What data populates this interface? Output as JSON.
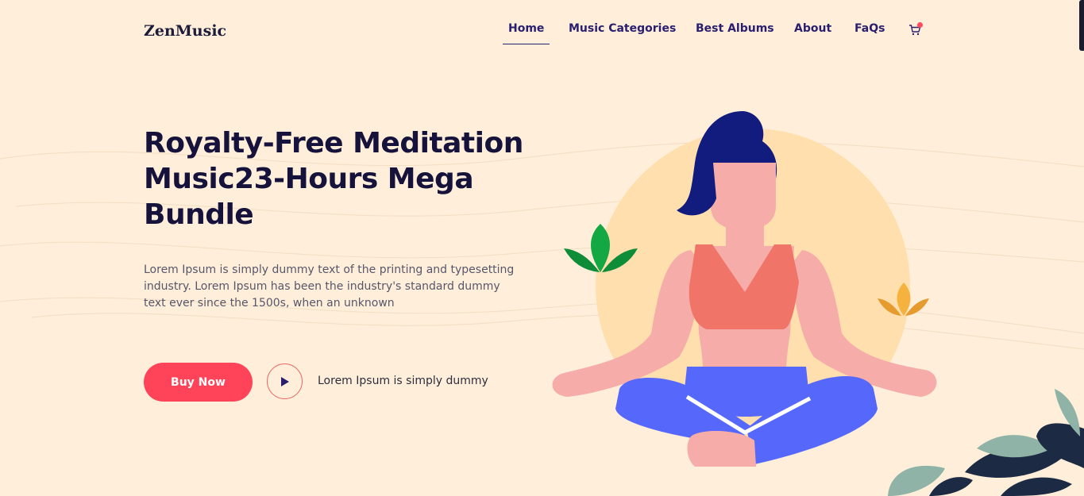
{
  "brand": {
    "logo": "ZenMusic"
  },
  "nav": {
    "items": [
      {
        "label": "Home",
        "active": true
      },
      {
        "label": "Music Categories",
        "active": false
      },
      {
        "label": "Best Albums",
        "active": false
      },
      {
        "label": "About",
        "active": false
      },
      {
        "label": "FaQs",
        "active": false
      }
    ],
    "cart_icon": "shopping-cart-icon"
  },
  "hero": {
    "title": "Royalty-Free Meditation Music23-Hours Mega Bundle",
    "description": "Lorem Ipsum is simply dummy text of the printing and typesetting industry. Lorem Ipsum has been the industry's standard dummy text ever since the 1500s, when an unknown",
    "buy_label": "Buy Now",
    "play_icon": "play-icon",
    "play_caption": "Lorem Ipsum is simply dummy"
  },
  "colors": {
    "background": "#FFEFDA",
    "accent": "#FF4459",
    "heading": "#15133C",
    "nav": "#2A1E6E"
  }
}
